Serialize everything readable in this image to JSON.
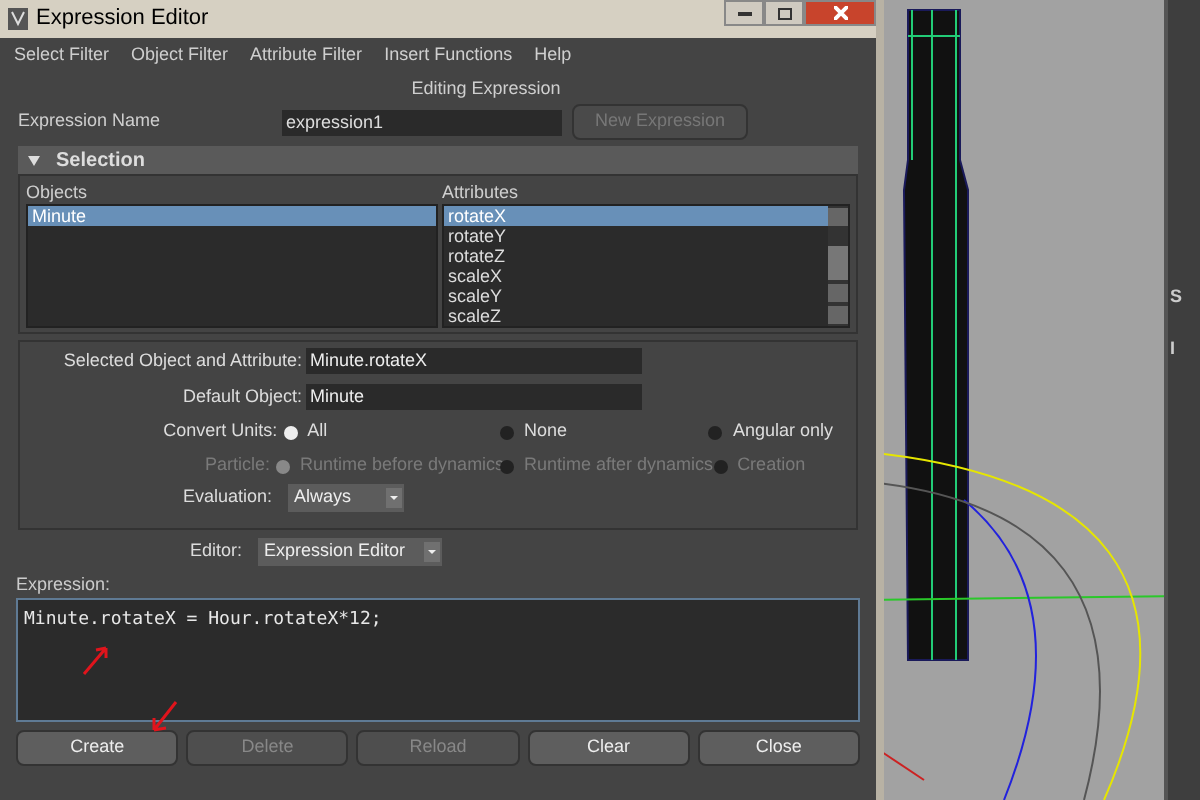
{
  "window": {
    "title": "Expression Editor"
  },
  "menu": [
    "Select Filter",
    "Object Filter",
    "Attribute Filter",
    "Insert Functions",
    "Help"
  ],
  "heading": "Editing Expression",
  "expression_name": {
    "label": "Expression Name",
    "value": "expression1",
    "button": {
      "label": "New Expression",
      "disabled": true
    }
  },
  "selection": {
    "title": "Selection",
    "expanded": true,
    "objects": {
      "label": "Objects",
      "items": [
        {
          "label": "Minute",
          "selected": true
        }
      ]
    },
    "attributes": {
      "label": "Attributes",
      "items": [
        {
          "label": "rotateX",
          "selected": true
        },
        {
          "label": "rotateY",
          "selected": false
        },
        {
          "label": "rotateZ",
          "selected": false
        },
        {
          "label": "scaleX",
          "selected": false
        },
        {
          "label": "scaleY",
          "selected": false
        },
        {
          "label": "scaleZ",
          "selected": false
        }
      ]
    }
  },
  "fields": [
    {
      "label": "Selected Object and Attribute:",
      "value": "Minute.rotateX"
    },
    {
      "label": "Default Object:",
      "value": "Minute"
    }
  ],
  "radio_groups": [
    {
      "label": "Convert Units:",
      "disabled": false,
      "options": [
        {
          "label": "All",
          "selected": true
        },
        {
          "label": "None",
          "selected": false
        },
        {
          "label": "Angular only",
          "selected": false
        }
      ]
    },
    {
      "label": "Particle:",
      "disabled": true,
      "options": [
        {
          "label": "Runtime before dynamics",
          "selected": true
        },
        {
          "label": "Runtime after dynamics",
          "selected": false
        },
        {
          "label": "Creation",
          "selected": false
        }
      ]
    }
  ],
  "evaluation": {
    "label": "Evaluation:",
    "value": "Always"
  },
  "editor": {
    "label": "Editor:",
    "value": "Expression Editor"
  },
  "expression": {
    "label": "Expression:",
    "value": "Minute.rotateX = Hour.rotateX*12;"
  },
  "buttons": [
    {
      "label": "Create",
      "disabled": false
    },
    {
      "label": "Delete",
      "disabled": true
    },
    {
      "label": "Reload",
      "disabled": true
    },
    {
      "label": "Clear",
      "disabled": false
    },
    {
      "label": "Close",
      "disabled": false
    }
  ],
  "side_panel": {
    "letters": [
      "S",
      "I"
    ]
  }
}
